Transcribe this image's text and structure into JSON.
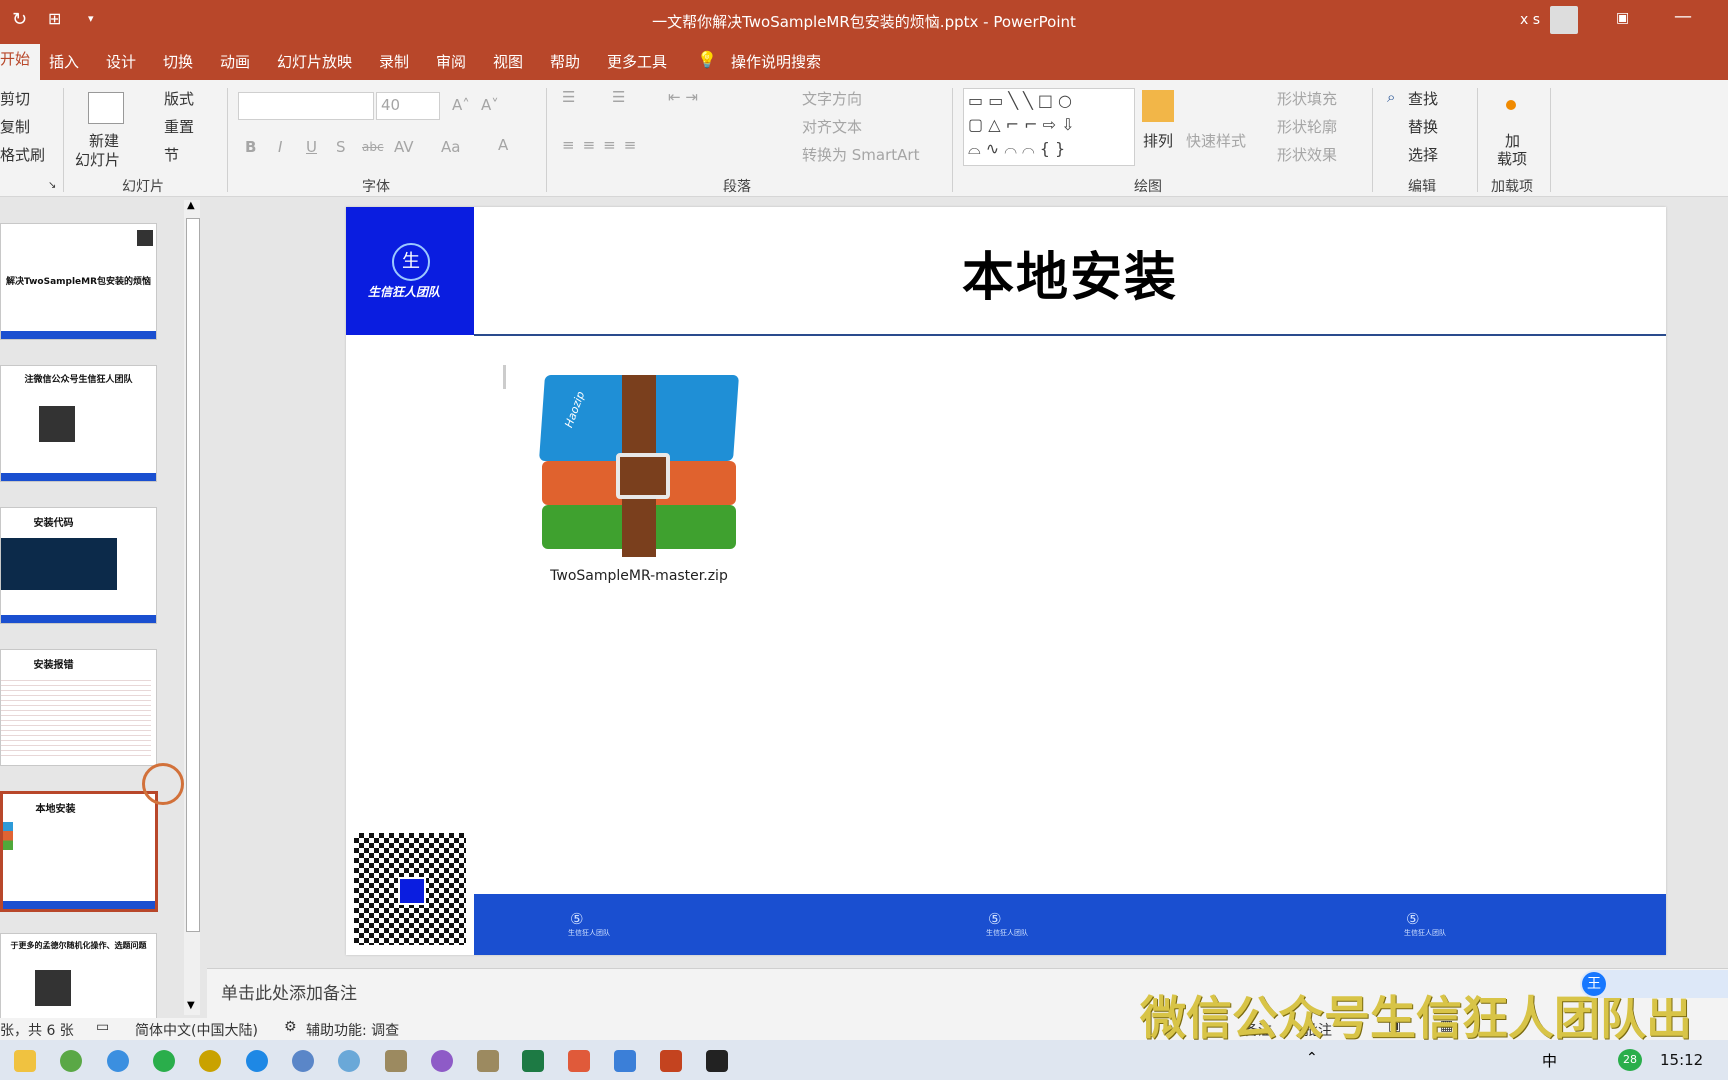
{
  "window": {
    "title": "一文帮你解决TwoSampleMR包安装的烦恼.pptx  -  PowerPoint",
    "user": "x s"
  },
  "tabs": [
    "开始",
    "插入",
    "设计",
    "切换",
    "动画",
    "幻灯片放映",
    "录制",
    "审阅",
    "视图",
    "帮助",
    "更多工具"
  ],
  "tell_me": "操作说明搜索",
  "ribbon": {
    "clipboard": {
      "cut": "剪切",
      "copy": "复制",
      "painter": "格式刷"
    },
    "slides": {
      "new_slide": "新建",
      "new_slide2": "幻灯片",
      "layout": "版式",
      "reset": "重置",
      "section": "节",
      "label": "幻灯片"
    },
    "font": {
      "size": "40",
      "label": "字体",
      "buttons": [
        "B",
        "I",
        "U",
        "S",
        "abc",
        "AV",
        "Aa",
        "A"
      ]
    },
    "paragraph": {
      "text_direction": "文字方向",
      "align_text": "对齐文本",
      "smartart": "转换为 SmartArt",
      "label": "段落"
    },
    "drawing": {
      "arrange": "排列",
      "quick_styles": "快速样式",
      "shape_fill": "形状填充",
      "shape_outline": "形状轮廓",
      "shape_effects": "形状效果",
      "label": "绘图"
    },
    "editing": {
      "find": "查找",
      "replace": "替换",
      "select": "选择",
      "label": "编辑"
    },
    "addins": {
      "btn": "加",
      "btn2": "载项",
      "label": "加载项"
    }
  },
  "thumbnails": [
    {
      "title": "解决TwoSampleMR包安装的烦恼"
    },
    {
      "title": "注微信公众号生信狂人团队"
    },
    {
      "title": "安装代码"
    },
    {
      "title": "安装报错"
    },
    {
      "title": "本地安装"
    },
    {
      "title": "于更多的孟德尔随机化操作、选题问题"
    }
  ],
  "slide": {
    "title": "本地安装",
    "logo_text": "生信狂人团队",
    "file_label": "TwoSampleMR-master.zip",
    "archive_brand": "Haozip",
    "footer_logo_text": "生信狂人团队"
  },
  "notes_placeholder": "单击此处添加备注",
  "status": {
    "slide_info": "张，共 6 张",
    "language": "简体中文(中国大陆)",
    "accessibility": "辅助功能: 调查",
    "notes": "备注",
    "comments": "批注"
  },
  "watermark": "微信公众号生信狂人团队出",
  "taskbar": {
    "time": "15:12",
    "ime": "中",
    "badge": "28"
  },
  "colors": {
    "accent": "#b8472a",
    "slide_blue": "#1a4fd0",
    "logo_blue": "#0a1de0"
  }
}
